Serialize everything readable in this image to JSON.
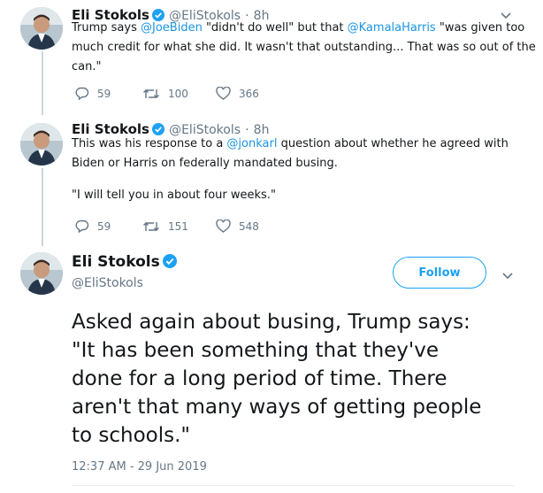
{
  "tweet1": {
    "name": "Eli Stokols",
    "handle": "@EliStokols",
    "sep": "·",
    "time": "8h",
    "line1": {
      "pre": "Trump says ",
      "m1": "@JoeBiden",
      "mid": " \"didn't do well\" but that ",
      "m2": "@KamalaHarris",
      "post": " \"was given too"
    },
    "line2": "much credit for what she did. It wasn't that outstanding... That was so out of the",
    "line3": "can.\"",
    "replies": "59",
    "retweets": "100",
    "likes": "366"
  },
  "tweet2": {
    "name": "Eli Stokols",
    "handle": "@EliStokols",
    "sep": "·",
    "time": "8h",
    "line1": {
      "pre": "This was his response to a ",
      "m1": "@jonkarl",
      "post": " question about whether he agreed with"
    },
    "line2": "Biden or Harris on federally mandated busing.",
    "line3": "\"I will tell you in about four weeks.\"",
    "replies": "59",
    "retweets": "151",
    "likes": "548"
  },
  "main": {
    "name": "Eli Stokols",
    "handle": "@EliStokols",
    "follow_label": "Follow",
    "text_lines": [
      "Asked again about busing, Trump says:",
      "\"It has been something that they've",
      "done for a long period of time. There",
      "aren't that many ways of getting people",
      "to schools.\""
    ],
    "timestamp": "12:37 AM - 29 Jun 2019"
  },
  "colors": {
    "accent": "#1da1f2",
    "mention": "#1b95e0",
    "muted": "#657786"
  },
  "icons": [
    "verified-badge-icon",
    "chevron-down-icon",
    "reply-icon",
    "retweet-icon",
    "like-icon"
  ]
}
